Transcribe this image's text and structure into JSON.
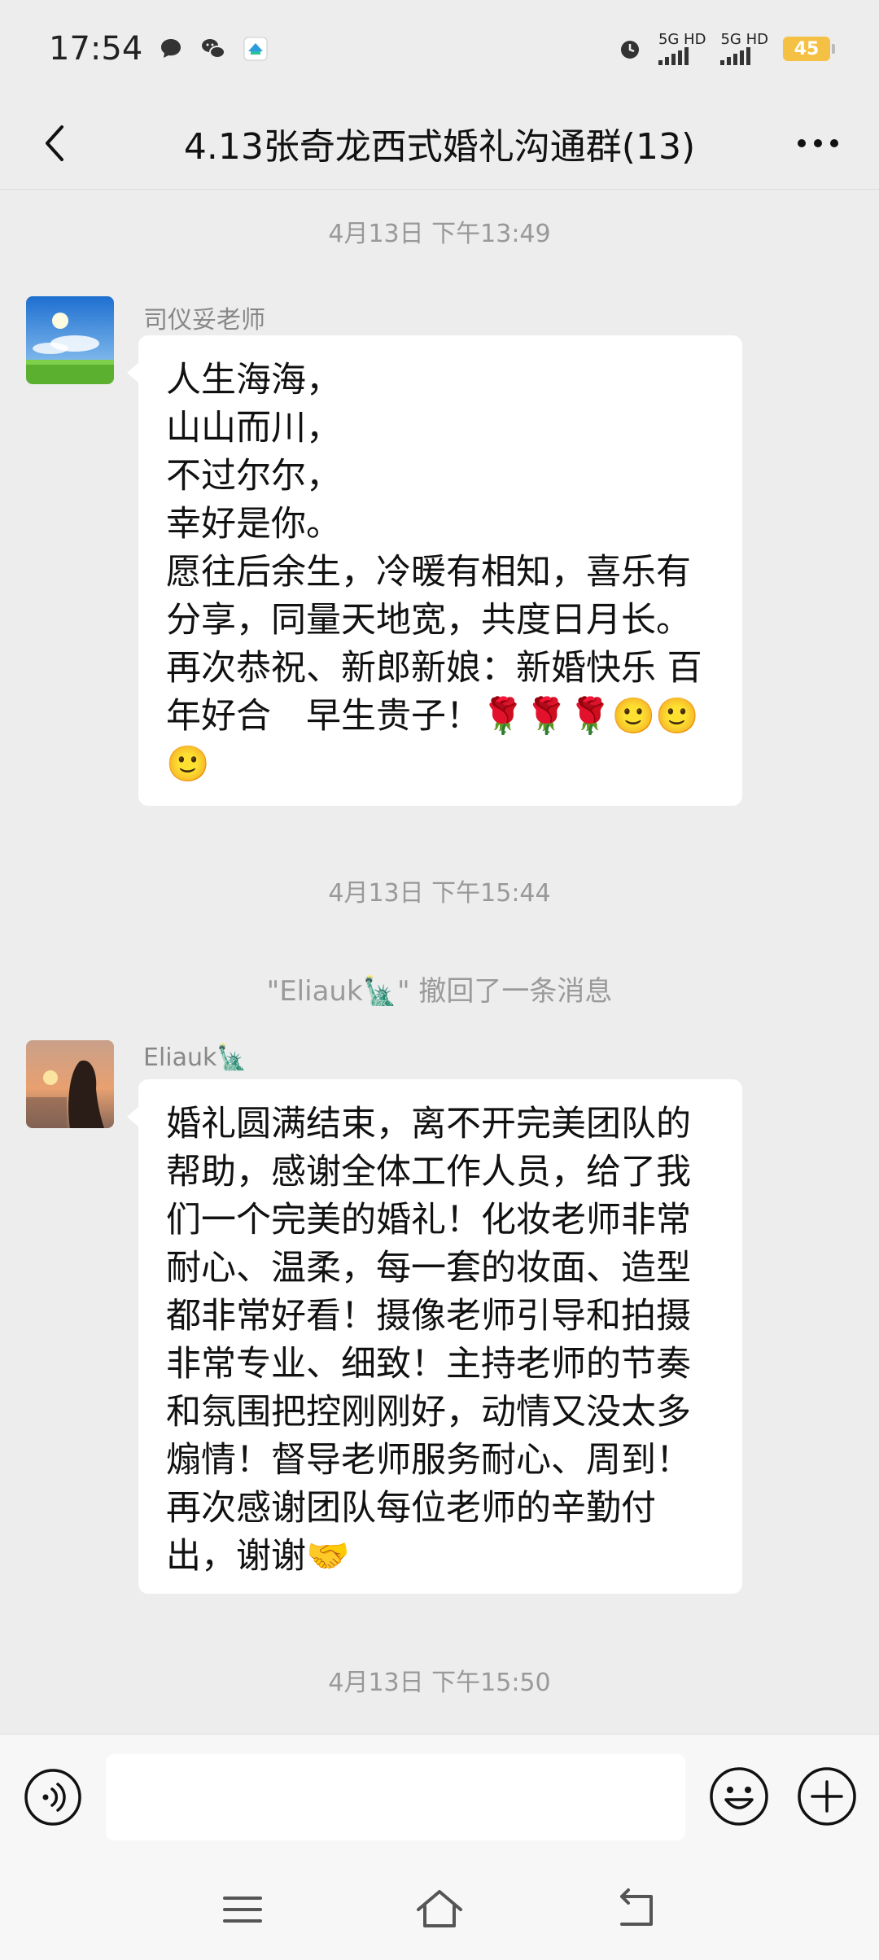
{
  "status_bar": {
    "time": "17:54",
    "network_1": "5G HD",
    "network_2": "5G HD",
    "battery": "45",
    "icons": [
      "message-bubble-icon",
      "wechat-icon",
      "app-notification-icon",
      "alarm-icon",
      "signal-icon",
      "signal-icon",
      "battery-icon"
    ]
  },
  "header": {
    "title": "4.13张奇龙西式婚礼沟通群(13)",
    "back_icon": "chevron-left-icon",
    "more_icon": "more-dots-icon"
  },
  "chat": {
    "timestamps": [
      "4月13日 下午13:49",
      "4月13日 下午15:44",
      "4月13日 下午15:50"
    ],
    "recall_notice": "\"Eliauk🗽\" 撤回了一条消息",
    "messages": [
      {
        "sender": "司仪妥老师",
        "avatar": "sky-landscape-avatar",
        "text": "人生海海，\n山山而川，\n不过尔尔，\n幸好是你。\n愿往后余生，冷暖有相知，喜乐有分享，同量天地宽，共度日月长。再次恭祝、新郎新娘：新婚快乐 百年好合　早生贵子！🌹🌹🌹🙂🙂🙂"
      },
      {
        "sender": "Eliauk🗽",
        "avatar": "sunset-portrait-avatar",
        "text": "婚礼圆满结束，离不开完美团队的帮助，感谢全体工作人员，给了我们一个完美的婚礼！化妆老师非常耐心、温柔，每一套的妆面、造型都非常好看！摄像老师引导和拍摄非常专业、细致！主持老师的节奏和氛围把控刚刚好，动情又没太多煽情！督导老师服务耐心、周到！再次感谢团队每位老师的辛勤付出，谢谢🤝"
      }
    ]
  },
  "input_bar": {
    "placeholder": "",
    "voice_icon": "voice-input-icon",
    "emoji_icon": "emoji-icon",
    "plus_icon": "plus-icon"
  },
  "nav_bar": {
    "icons": [
      "menu-icon",
      "home-icon",
      "back-icon"
    ]
  }
}
